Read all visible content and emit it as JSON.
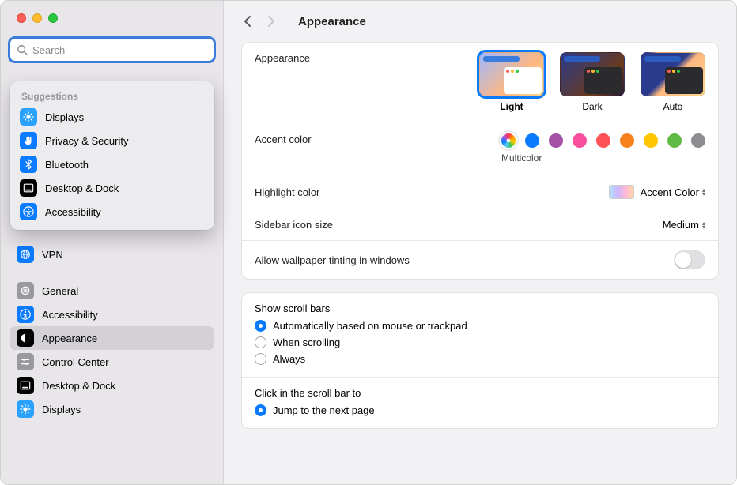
{
  "search_placeholder": "Search",
  "suggestions_header": "Suggestions",
  "suggestions": [
    {
      "label": "Displays",
      "color": "#2aa1ff",
      "icon": "sun"
    },
    {
      "label": "Privacy & Security",
      "color": "#0a7aff",
      "icon": "hand"
    },
    {
      "label": "Bluetooth",
      "color": "#0a7aff",
      "icon": "bluetooth"
    },
    {
      "label": "Desktop & Dock",
      "color": "#000000",
      "icon": "dock"
    },
    {
      "label": "Accessibility",
      "color": "#0a7aff",
      "icon": "accessibility"
    }
  ],
  "sidebar": [
    {
      "label": "VPN",
      "color": "#0a7aff",
      "icon": "globe"
    },
    {
      "spacer": true
    },
    {
      "label": "General",
      "color": "#9a9a9e",
      "icon": "gear"
    },
    {
      "label": "Accessibility",
      "color": "#0a7aff",
      "icon": "accessibility"
    },
    {
      "label": "Appearance",
      "color": "#000000",
      "icon": "appearance",
      "selected": true
    },
    {
      "label": "Control Center",
      "color": "#9a9a9e",
      "icon": "sliders"
    },
    {
      "label": "Desktop & Dock",
      "color": "#000000",
      "icon": "dock"
    },
    {
      "label": "Displays",
      "color": "#2aa1ff",
      "icon": "sun"
    }
  ],
  "page_title": "Appearance",
  "appearance_label": "Appearance",
  "appearance_thumbs": [
    {
      "label": "Light",
      "mode": "light",
      "selected": true
    },
    {
      "label": "Dark",
      "mode": "dark"
    },
    {
      "label": "Auto",
      "mode": "auto"
    }
  ],
  "accent_label": "Accent color",
  "accent_sub": "Multicolor",
  "accent_colors": [
    {
      "name": "multicolor",
      "css": "multicolor",
      "selected": true
    },
    {
      "name": "blue",
      "css": "#0a7aff"
    },
    {
      "name": "purple",
      "css": "#a550a7"
    },
    {
      "name": "pink",
      "css": "#f74f9e"
    },
    {
      "name": "red",
      "css": "#ff5257"
    },
    {
      "name": "orange",
      "css": "#f7821b"
    },
    {
      "name": "yellow",
      "css": "#ffc600"
    },
    {
      "name": "green",
      "css": "#62ba46"
    },
    {
      "name": "graphite",
      "css": "#8c8c91"
    }
  ],
  "highlight_label": "Highlight color",
  "highlight_value": "Accent Color",
  "sidebar_icon_label": "Sidebar icon size",
  "sidebar_icon_value": "Medium",
  "tint_label": "Allow wallpaper tinting in windows",
  "scrollbars_header": "Show scroll bars",
  "scrollbars_options": [
    {
      "label": "Automatically based on mouse or trackpad",
      "checked": true
    },
    {
      "label": "When scrolling"
    },
    {
      "label": "Always"
    }
  ],
  "click_header": "Click in the scroll bar to",
  "click_options": [
    {
      "label": "Jump to the next page",
      "checked": true
    }
  ]
}
